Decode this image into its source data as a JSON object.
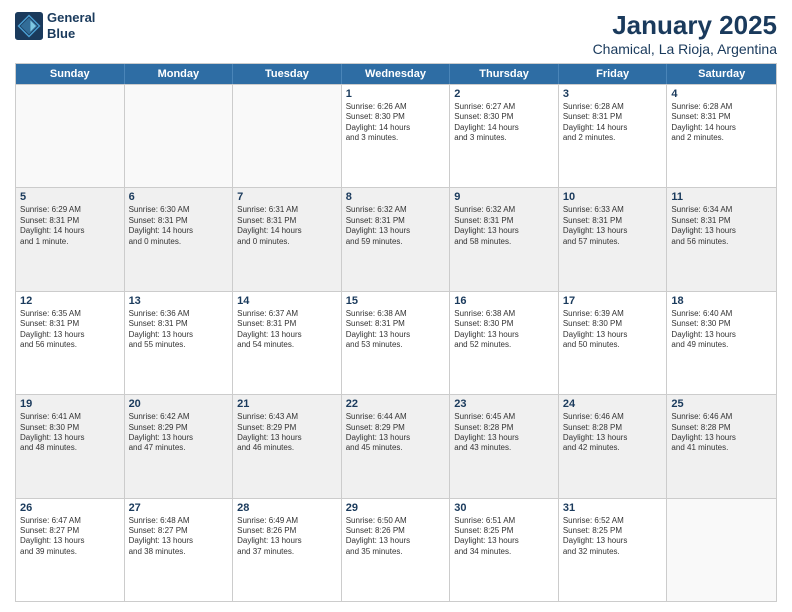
{
  "logo": {
    "line1": "General",
    "line2": "Blue"
  },
  "title": "January 2025",
  "subtitle": "Chamical, La Rioja, Argentina",
  "days": [
    "Sunday",
    "Monday",
    "Tuesday",
    "Wednesday",
    "Thursday",
    "Friday",
    "Saturday"
  ],
  "rows": [
    [
      {
        "day": "",
        "text": "",
        "empty": true
      },
      {
        "day": "",
        "text": "",
        "empty": true
      },
      {
        "day": "",
        "text": "",
        "empty": true
      },
      {
        "day": "1",
        "text": "Sunrise: 6:26 AM\nSunset: 8:30 PM\nDaylight: 14 hours\nand 3 minutes.",
        "shaded": false
      },
      {
        "day": "2",
        "text": "Sunrise: 6:27 AM\nSunset: 8:30 PM\nDaylight: 14 hours\nand 3 minutes.",
        "shaded": false
      },
      {
        "day": "3",
        "text": "Sunrise: 6:28 AM\nSunset: 8:31 PM\nDaylight: 14 hours\nand 2 minutes.",
        "shaded": false
      },
      {
        "day": "4",
        "text": "Sunrise: 6:28 AM\nSunset: 8:31 PM\nDaylight: 14 hours\nand 2 minutes.",
        "shaded": false
      }
    ],
    [
      {
        "day": "5",
        "text": "Sunrise: 6:29 AM\nSunset: 8:31 PM\nDaylight: 14 hours\nand 1 minute.",
        "shaded": true
      },
      {
        "day": "6",
        "text": "Sunrise: 6:30 AM\nSunset: 8:31 PM\nDaylight: 14 hours\nand 0 minutes.",
        "shaded": true
      },
      {
        "day": "7",
        "text": "Sunrise: 6:31 AM\nSunset: 8:31 PM\nDaylight: 14 hours\nand 0 minutes.",
        "shaded": true
      },
      {
        "day": "8",
        "text": "Sunrise: 6:32 AM\nSunset: 8:31 PM\nDaylight: 13 hours\nand 59 minutes.",
        "shaded": true
      },
      {
        "day": "9",
        "text": "Sunrise: 6:32 AM\nSunset: 8:31 PM\nDaylight: 13 hours\nand 58 minutes.",
        "shaded": true
      },
      {
        "day": "10",
        "text": "Sunrise: 6:33 AM\nSunset: 8:31 PM\nDaylight: 13 hours\nand 57 minutes.",
        "shaded": true
      },
      {
        "day": "11",
        "text": "Sunrise: 6:34 AM\nSunset: 8:31 PM\nDaylight: 13 hours\nand 56 minutes.",
        "shaded": true
      }
    ],
    [
      {
        "day": "12",
        "text": "Sunrise: 6:35 AM\nSunset: 8:31 PM\nDaylight: 13 hours\nand 56 minutes.",
        "shaded": false
      },
      {
        "day": "13",
        "text": "Sunrise: 6:36 AM\nSunset: 8:31 PM\nDaylight: 13 hours\nand 55 minutes.",
        "shaded": false
      },
      {
        "day": "14",
        "text": "Sunrise: 6:37 AM\nSunset: 8:31 PM\nDaylight: 13 hours\nand 54 minutes.",
        "shaded": false
      },
      {
        "day": "15",
        "text": "Sunrise: 6:38 AM\nSunset: 8:31 PM\nDaylight: 13 hours\nand 53 minutes.",
        "shaded": false
      },
      {
        "day": "16",
        "text": "Sunrise: 6:38 AM\nSunset: 8:30 PM\nDaylight: 13 hours\nand 52 minutes.",
        "shaded": false
      },
      {
        "day": "17",
        "text": "Sunrise: 6:39 AM\nSunset: 8:30 PM\nDaylight: 13 hours\nand 50 minutes.",
        "shaded": false
      },
      {
        "day": "18",
        "text": "Sunrise: 6:40 AM\nSunset: 8:30 PM\nDaylight: 13 hours\nand 49 minutes.",
        "shaded": false
      }
    ],
    [
      {
        "day": "19",
        "text": "Sunrise: 6:41 AM\nSunset: 8:30 PM\nDaylight: 13 hours\nand 48 minutes.",
        "shaded": true
      },
      {
        "day": "20",
        "text": "Sunrise: 6:42 AM\nSunset: 8:29 PM\nDaylight: 13 hours\nand 47 minutes.",
        "shaded": true
      },
      {
        "day": "21",
        "text": "Sunrise: 6:43 AM\nSunset: 8:29 PM\nDaylight: 13 hours\nand 46 minutes.",
        "shaded": true
      },
      {
        "day": "22",
        "text": "Sunrise: 6:44 AM\nSunset: 8:29 PM\nDaylight: 13 hours\nand 45 minutes.",
        "shaded": true
      },
      {
        "day": "23",
        "text": "Sunrise: 6:45 AM\nSunset: 8:28 PM\nDaylight: 13 hours\nand 43 minutes.",
        "shaded": true
      },
      {
        "day": "24",
        "text": "Sunrise: 6:46 AM\nSunset: 8:28 PM\nDaylight: 13 hours\nand 42 minutes.",
        "shaded": true
      },
      {
        "day": "25",
        "text": "Sunrise: 6:46 AM\nSunset: 8:28 PM\nDaylight: 13 hours\nand 41 minutes.",
        "shaded": true
      }
    ],
    [
      {
        "day": "26",
        "text": "Sunrise: 6:47 AM\nSunset: 8:27 PM\nDaylight: 13 hours\nand 39 minutes.",
        "shaded": false
      },
      {
        "day": "27",
        "text": "Sunrise: 6:48 AM\nSunset: 8:27 PM\nDaylight: 13 hours\nand 38 minutes.",
        "shaded": false
      },
      {
        "day": "28",
        "text": "Sunrise: 6:49 AM\nSunset: 8:26 PM\nDaylight: 13 hours\nand 37 minutes.",
        "shaded": false
      },
      {
        "day": "29",
        "text": "Sunrise: 6:50 AM\nSunset: 8:26 PM\nDaylight: 13 hours\nand 35 minutes.",
        "shaded": false
      },
      {
        "day": "30",
        "text": "Sunrise: 6:51 AM\nSunset: 8:25 PM\nDaylight: 13 hours\nand 34 minutes.",
        "shaded": false
      },
      {
        "day": "31",
        "text": "Sunrise: 6:52 AM\nSunset: 8:25 PM\nDaylight: 13 hours\nand 32 minutes.",
        "shaded": false
      },
      {
        "day": "",
        "text": "",
        "empty": true
      }
    ]
  ]
}
